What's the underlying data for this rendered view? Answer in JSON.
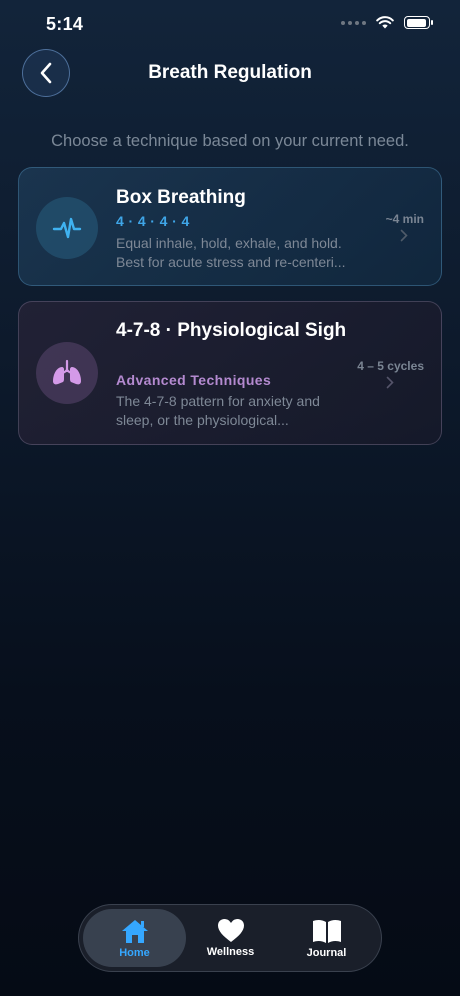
{
  "status": {
    "time": "5:14"
  },
  "header": {
    "title": "Breath Regulation",
    "subtitle": "Choose a technique based on your current need."
  },
  "techniques": [
    {
      "title": "Box Breathing",
      "tag": "4 · 4 · 4 · 4",
      "description": "Equal inhale, hold, exhale, and hold. Best for acute stress and re-centeri...",
      "meta": "~4 min",
      "icon": "pulse-icon",
      "accent": "#3fa6e8"
    },
    {
      "title": "4-7-8  ·  Physiological Sigh",
      "tag": "Advanced Techniques",
      "description": "The 4-7-8 pattern for anxiety and sleep, or the physiological...",
      "meta": "4 – 5 cycles",
      "icon": "lungs-icon",
      "accent": "#b48ad0"
    }
  ],
  "tabbar": {
    "items": [
      {
        "label": "Home",
        "icon": "home-icon",
        "active": true,
        "color": "#35a7ff"
      },
      {
        "label": "Wellness",
        "icon": "heart-icon",
        "active": false,
        "color": "#ffffff"
      },
      {
        "label": "Journal",
        "icon": "book-icon",
        "active": false,
        "color": "#ffffff"
      }
    ]
  }
}
